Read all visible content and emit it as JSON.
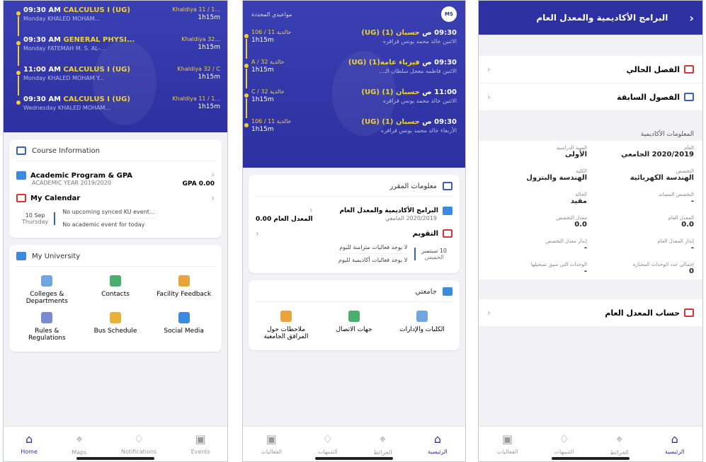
{
  "p1": {
    "schedule": [
      {
        "time": "09:30 AM",
        "course": "CALCULUS I (UG)",
        "room": "Khaldiya 11 / 1...",
        "day": "Monday",
        "instructor": "KHALED MOHAM...",
        "dur": "1h15m"
      },
      {
        "time": "09:30 AM",
        "course": "GENERAL PHYSI...",
        "room": "Khaldiya 32...",
        "day": "Monday",
        "instructor": "FATEMAH M. S. AL-...",
        "dur": "1h15m"
      },
      {
        "time": "11:00 AM",
        "course": "CALCULUS I (UG)",
        "room": "Khaldiya 32 / C",
        "day": "Monday",
        "instructor": "KHALED MOHAM Y...",
        "dur": "1h15m"
      },
      {
        "time": "09:30 AM",
        "course": "CALCULUS I (UG)",
        "room": "Khaldiya 11 / 1...",
        "day": "Wednesday",
        "instructor": "KHALED MOHAM...",
        "dur": "1h15m"
      }
    ],
    "course_info_title": "Course Information",
    "academic_program": "Academic Program & GPA",
    "academic_year": "ACADEMIC YEAR 2019/2020",
    "gpa": "GPA 0.00",
    "calendar": "My Calendar",
    "cal_date": "10 Sep",
    "cal_day": "Thursday",
    "cal_msg1": "No upcoming synced KU event...",
    "cal_msg2": "No academic event for today",
    "univ_title": "My University",
    "univ_items": [
      "Colleges & Departments",
      "Contacts",
      "Facility Feedback",
      "Rules & Regulations",
      "Bus Schedule",
      "Social Media"
    ],
    "tabs": [
      "Home",
      "Maps",
      "Notifications",
      "Events"
    ]
  },
  "p2": {
    "avatar": "MS",
    "header": "مواعيدي المحددة",
    "schedule": [
      {
        "time": "09:30 ص",
        "course": "حسبان (1) (UG)",
        "room": "خالدية 11 / 106",
        "day": "الاثنين",
        "instructor": "خالد محمد يونس قراقره",
        "dur": "1h15m"
      },
      {
        "time": "09:30 ص",
        "course": "فيزياء عامه(1) (UG)",
        "room": "خالدية 32 / A",
        "day": "الاثنين",
        "instructor": "فاطمه معجل سلطان الـ...",
        "dur": "1h15m"
      },
      {
        "time": "11:00 ص",
        "course": "حسبان (1) (UG)",
        "room": "خالدية 32 / C",
        "day": "الاثنين",
        "instructor": "خالد محمد يونس قراقره",
        "dur": "1h15m"
      },
      {
        "time": "09:30 ص",
        "course": "حسبان (1) (UG)",
        "room": "خالدية 11 / 106",
        "day": "الأربعاء",
        "instructor": "خالد محمد يونس قراقره",
        "dur": "1h15m"
      }
    ],
    "course_info_title": "معلومات المقرر",
    "academic_program": "البرامج الأكاديمية والمعدل العام",
    "academic_year": "2020/2019 الجامعي",
    "gpa": "المعدل العام 0.00",
    "calendar": "التقويم",
    "cal_date": "10 سبتمبر",
    "cal_day": "الخميس",
    "cal_msg1": "لا يوجد فعاليات متزامنة لليوم",
    "cal_msg2": "لا يوجد فعاليات أكاديمية لليوم",
    "univ_title": "جامعتي",
    "univ_items": [
      "الكليات والإدارات",
      "جهات الاتصال",
      "ملاحظات حول المرافق الجامعية"
    ],
    "tabs": [
      "الرئيسية",
      "الخرائط",
      "التنبيهات",
      "الفعاليات"
    ]
  },
  "p3": {
    "title": "البرامج الأكاديمية والمعدل العام",
    "current": "الفصل الحالي",
    "previous": "الفصول السابقة",
    "section": "المعلومات الأكاديمية",
    "fields": [
      {
        "label": "العام",
        "value": "2020/2019 الجامعي"
      },
      {
        "label": "السنة الدراسية",
        "value": "الأولى"
      },
      {
        "label": "التخصص",
        "value": "الهندسة الكهربائية"
      },
      {
        "label": "الكلية",
        "value": "الهندسة والبترول"
      },
      {
        "label": "التخصص المساند",
        "value": "-"
      },
      {
        "label": "الحالة",
        "value": "مقيد"
      },
      {
        "label": "المعدل العام",
        "value": "0.0"
      },
      {
        "label": "معدل التخصص",
        "value": "0.0"
      },
      {
        "label": "إنذار المعدل العام",
        "value": "-"
      },
      {
        "label": "إنذار معدل التخصص",
        "value": "-"
      },
      {
        "label": "إجمالي عدد الوحدات المجتازة",
        "value": "0"
      },
      {
        "label": "الوحدات التي سبق تسجيلها",
        "value": "-"
      }
    ],
    "gpa_calc": "حساب المعدل العام",
    "tabs": [
      "الرئيسية",
      "الخرائط",
      "التنبيهات",
      "الفعاليات"
    ]
  }
}
